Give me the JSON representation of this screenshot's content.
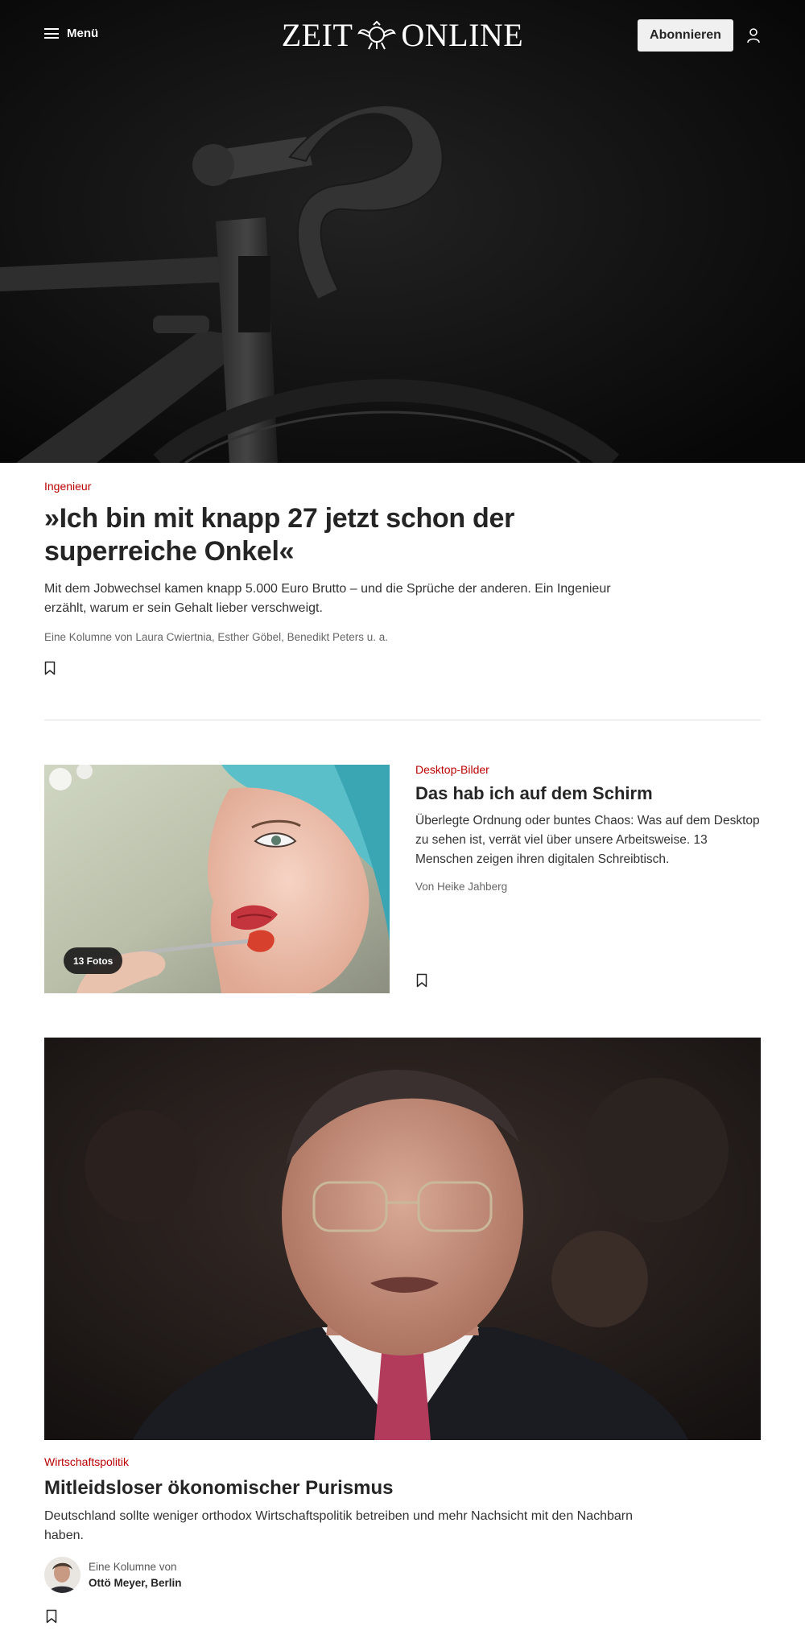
{
  "header": {
    "menu_label": "Menü",
    "logo_left": "ZEIT",
    "logo_right": "ONLINE",
    "subscribe_label": "Abonnieren"
  },
  "articles": [
    {
      "kicker": "Ingenieur",
      "title": "»Ich bin mit knapp 27 jetzt schon der superreiche Onkel«",
      "teaser": "Mit dem Jobwechsel kamen knapp 5.000 Euro Brutto – und die Sprüche der anderen. Ein Ingenieur erzählt, warum er sein Gehalt lieber verschweigt.",
      "byline": "Eine Kolumne von Laura Cwiertnia, Esther Göbel, Benedikt Peters u. a.",
      "image": "bicycle-handlebar-photo"
    },
    {
      "kicker": "Desktop-Bilder",
      "title": "Das hab ich auf dem Schirm",
      "teaser": "Überlegte Ordnung oder buntes Chaos: Was auf dem Desktop zu sehen ist, verrät viel über unsere Arbeitsweise. 13 Menschen zeigen ihren digitalen Schreibtisch.",
      "byline": "Von Heike Jahberg",
      "photo_badge": "13 Fotos",
      "image": "woman-eating-photo"
    },
    {
      "kicker": "Wirtschaftspolitik",
      "title": "Mitleidsloser ökonomischer Purismus",
      "teaser": "Deutschland sollte weniger orthodox Wirtschaftspolitik betreiben und mehr Nachsicht mit den Nachbarn haben.",
      "author_prefix": "Eine Kolumne von",
      "author_name": "Ottö Meyer, Berlin",
      "image": "elderly-man-portrait-photo"
    }
  ],
  "icons": {
    "menu": "hamburger-icon",
    "user": "user-icon",
    "bookmark": "bookmark-icon"
  },
  "colors": {
    "kicker": "#bb0000",
    "header_background": "#111111",
    "subscribe_background": "#f0f0f0"
  }
}
